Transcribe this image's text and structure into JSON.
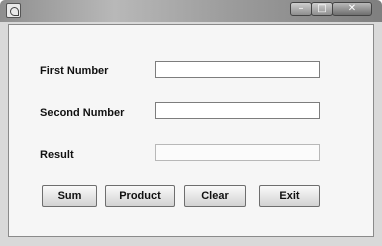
{
  "window": {
    "controls": {
      "minimize_icon": "minimize-icon",
      "maximize_icon": "maximize-icon",
      "close_icon": "close-icon"
    }
  },
  "form": {
    "first_number_label": "First Number",
    "first_number_value": "",
    "second_number_label": "Second Number",
    "second_number_value": "",
    "result_label": "Result",
    "result_value": ""
  },
  "buttons": {
    "sum": "Sum",
    "product": "Product",
    "clear": "Clear",
    "exit": "Exit"
  },
  "glyphs": {
    "minimize": "–",
    "maximize": "□",
    "close": "✕"
  }
}
